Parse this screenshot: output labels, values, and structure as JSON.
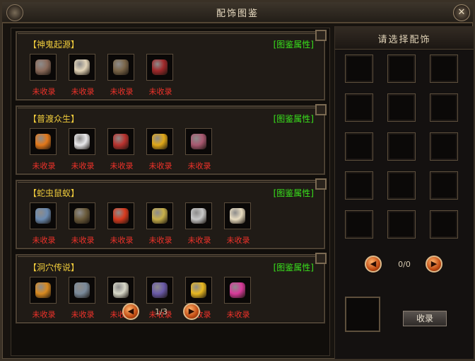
{
  "window": {
    "title": "配饰图鉴",
    "close_icon": "close-icon"
  },
  "panels": [
    {
      "name": "【神鬼起源】",
      "attr_link": "[图鉴属性]",
      "items": [
        {
          "icon": "armor-icon",
          "status": "未收录",
          "color": "#8a6a5a"
        },
        {
          "icon": "bone-icon",
          "status": "未收录",
          "color": "#e2d4b8"
        },
        {
          "icon": "claw-icon",
          "status": "未收录",
          "color": "#7a6548"
        },
        {
          "icon": "heart-icon",
          "status": "未收录",
          "color": "#a0282a"
        }
      ]
    },
    {
      "name": "【普渡众生】",
      "attr_link": "[图鉴属性]",
      "items": [
        {
          "icon": "scroll-icon",
          "status": "未收录",
          "color": "#e2781a"
        },
        {
          "icon": "pearl-icon",
          "status": "未收录",
          "color": "#e8e8ea"
        },
        {
          "icon": "talisman-icon",
          "status": "未收录",
          "color": "#b8322e"
        },
        {
          "icon": "gold-ore-icon",
          "status": "未收录",
          "color": "#e0a818"
        },
        {
          "icon": "book-icon",
          "status": "未收录",
          "color": "#a85870"
        }
      ]
    },
    {
      "name": "【蛇虫鼠蚁】",
      "attr_link": "[图鉴属性]",
      "items": [
        {
          "icon": "insect-icon",
          "status": "未收录",
          "color": "#6a8ab0"
        },
        {
          "icon": "shell-icon",
          "status": "未收录",
          "color": "#6a5a3a"
        },
        {
          "icon": "pepper-icon",
          "status": "未收录",
          "color": "#d83a1e"
        },
        {
          "icon": "snake-icon",
          "status": "未收录",
          "color": "#c8b04a"
        },
        {
          "icon": "skeleton-icon",
          "status": "未收录",
          "color": "#c8c8c8"
        },
        {
          "icon": "fang-icon",
          "status": "未收录",
          "color": "#e8dcc0"
        }
      ]
    },
    {
      "name": "【洞穴传说】",
      "attr_link": "[图鉴属性]",
      "items": [
        {
          "icon": "torch-icon",
          "status": "未收录",
          "color": "#d88a20"
        },
        {
          "icon": "gauntlet-icon",
          "status": "未收录",
          "color": "#7a8a9a"
        },
        {
          "icon": "crystal-icon",
          "status": "未收录",
          "color": "#d8d8c8"
        },
        {
          "icon": "demon-mask-icon",
          "status": "未收录",
          "color": "#6a5aa8"
        },
        {
          "icon": "medallion-icon",
          "status": "未收录",
          "color": "#e8b820"
        },
        {
          "icon": "pink-mask-icon",
          "status": "未收录",
          "color": "#d83a9a"
        }
      ]
    }
  ],
  "pager_left": {
    "text": "1/3",
    "prev_icon": "arrow-left-icon",
    "next_icon": "arrow-right-icon"
  },
  "right": {
    "title": "请选择配饰",
    "slot_count": 15,
    "pager_text": "0/0",
    "collect_label": "收录"
  }
}
